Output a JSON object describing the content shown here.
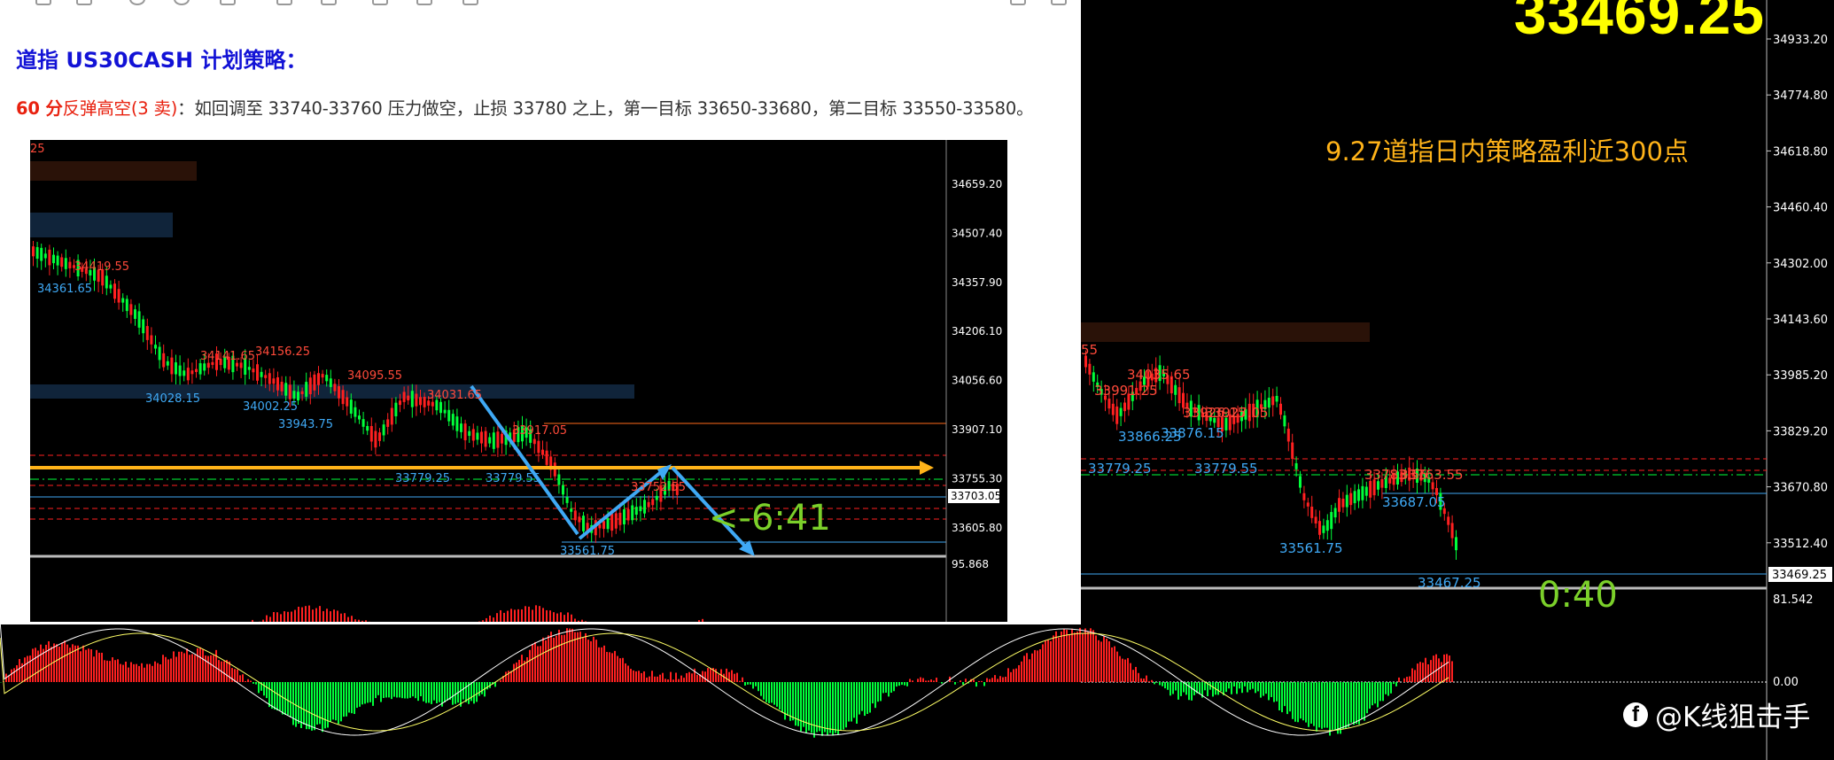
{
  "colors": {
    "bull": "#00ff3a",
    "bear": "#ff2020",
    "blue_label": "#3fa9f5",
    "red_label": "#ff4a3a",
    "yellow": "#ffff00",
    "orange_arrow": "#ffb319",
    "title_blue": "#1212d6",
    "text_red": "#e8210f"
  },
  "main_chart": {
    "big_price": "33469.25",
    "caption": "9.27道指日内策略盈利近300点",
    "price_axis": [
      "34933.20",
      "34774.80",
      "34618.80",
      "34460.40",
      "34302.00",
      "34143.60",
      "33985.20",
      "33829.20",
      "33670.80",
      "33512.40"
    ],
    "current_price_tag": "33469.25",
    "osc_axis": [
      "81.542",
      "0.00"
    ],
    "labels": [
      "55",
      "33991.25",
      "34035.65",
      "33926.15",
      "33927.05",
      "33866.25",
      "33876.15",
      "33779.25",
      "33779.55",
      "33783.55",
      "33763.55",
      "33687.05",
      "33561.75",
      "33467.25"
    ],
    "countdown_partial": "0:40"
  },
  "watermark": {
    "icon": "facebook-icon",
    "text": "@K线狙击手"
  },
  "article": {
    "title": "道指 US30CASH 计划策略：",
    "strategy_prefix": "60 分",
    "strategy_tag": "反弹高空(3 卖)",
    "strategy_text": "：如回调至 33740-33760 压力做空，止损 33780 之上，第一目标 33650-33680，第二目标 33550-33580。"
  },
  "inner_chart": {
    "price_axis": [
      "34659.20",
      "34507.40",
      "34357.90",
      "34206.10",
      "34056.60",
      "33907.10",
      "33755.30",
      "33605.80"
    ],
    "current_price_tag": "33703.05",
    "osc_value": "95.868",
    "corner_label": "25",
    "countdown": "<-6:41",
    "labels": [
      "34361.65",
      "34419.55",
      "34028.15",
      "34141.65",
      "34156.25",
      "34002.25",
      "33943.75",
      "34095.55",
      "34031.65",
      "33917.05",
      "33779.25",
      "33779.55",
      "33561.75",
      "33752.55"
    ]
  }
}
